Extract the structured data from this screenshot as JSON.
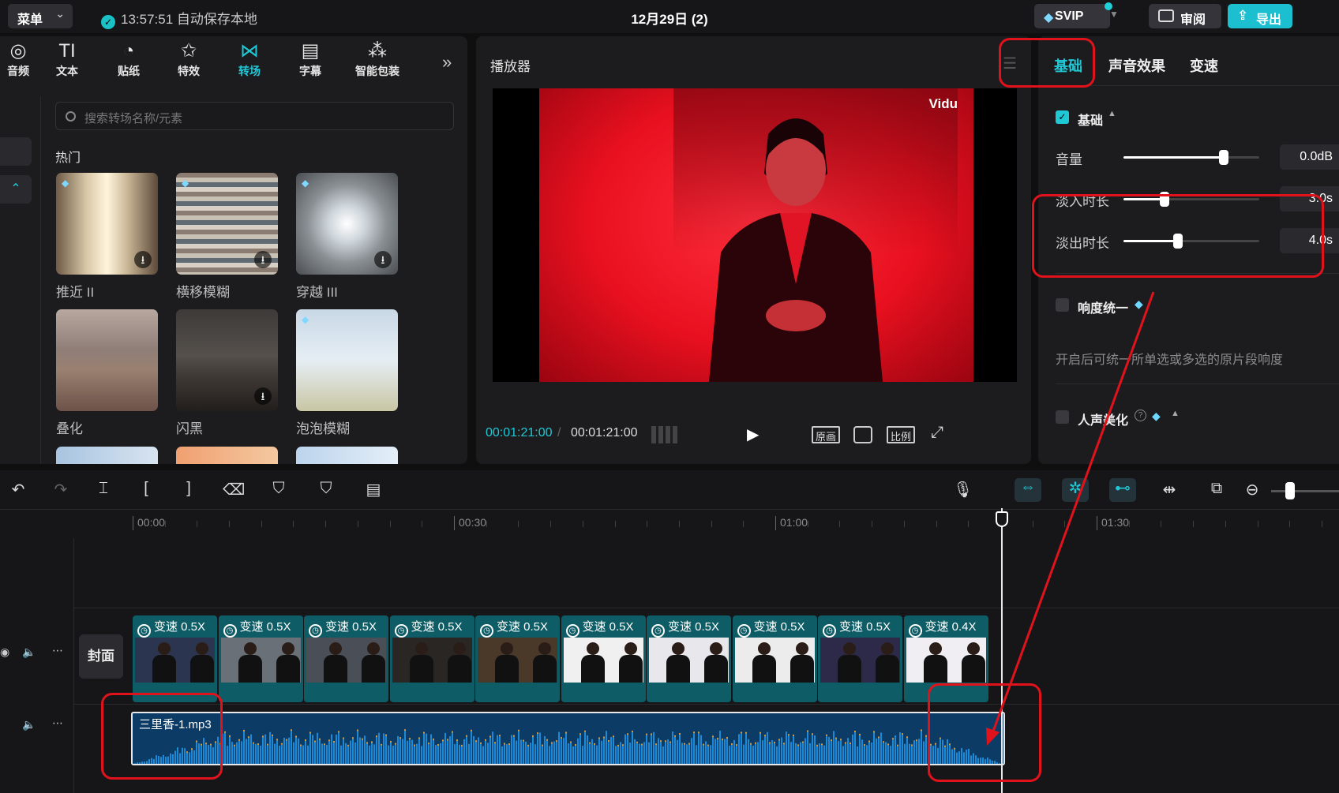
{
  "topbar": {
    "menu_label": "菜单",
    "save_status": "13:57:51 自动保存本地",
    "project_title": "12月29日 (2)",
    "svip_label": "SVIP",
    "review_label": "审阅",
    "export_label": "导出"
  },
  "tools": [
    {
      "label": "音频",
      "icon": "audio-icon",
      "glyph": "◎"
    },
    {
      "label": "文本",
      "icon": "text-icon",
      "glyph": "TI"
    },
    {
      "label": "贴纸",
      "icon": "sticker-icon",
      "glyph": "◔"
    },
    {
      "label": "特效",
      "icon": "effects-icon",
      "glyph": "✩"
    },
    {
      "label": "转场",
      "icon": "transition-icon",
      "glyph": "⋈",
      "active": true
    },
    {
      "label": "字幕",
      "icon": "subtitle-icon",
      "glyph": "▤"
    },
    {
      "label": "智能包装",
      "icon": "smart-pack-icon",
      "glyph": "⁂"
    }
  ],
  "transitions": {
    "search_placeholder": "搜索转场名称/元素",
    "section_label": "热门",
    "items": [
      "推近 II",
      "横移模糊",
      "穿越 III",
      "叠化",
      "闪黑",
      "泡泡模糊"
    ]
  },
  "player": {
    "title": "播放器",
    "watermark": "Vidu",
    "current_time": "00:01:21:00",
    "separator": "/",
    "total_time": "00:01:21:00",
    "btn_original": "原画",
    "btn_ratio": "比例"
  },
  "right_panel": {
    "tabs": [
      "基础",
      "声音效果",
      "变速"
    ],
    "active_tab": "基础",
    "section_basic": "基础",
    "volume_label": "音量",
    "volume_value": "0.0dB",
    "volume_level": 0.74,
    "fade_in_label": "淡入时长",
    "fade_in_value": "3.0s",
    "fade_in_level": 0.3,
    "fade_out_label": "淡出时长",
    "fade_out_value": "4.0s",
    "fade_out_level": 0.4,
    "loudness_label": "响度统一",
    "loudness_desc": "开启后可统一所单选或多选的原片段响度",
    "voice_label": "人声美化"
  },
  "timeline": {
    "ruler": [
      "00:00",
      "00:30",
      "01:00",
      "01:30"
    ],
    "cover_label": "封面",
    "clips": [
      "变速 0.5X",
      "变速 0.5X",
      "变速 0.5X",
      "变速 0.5X",
      "变速 0.5X",
      "变速 0.5X",
      "变速 0.5X",
      "变速 0.5X",
      "变速 0.5X",
      "变速 0.4X"
    ],
    "audio_clip": "三里香-1.mp3"
  },
  "colors": {
    "accent": "#20c8d6",
    "annotation": "#e0121c"
  }
}
